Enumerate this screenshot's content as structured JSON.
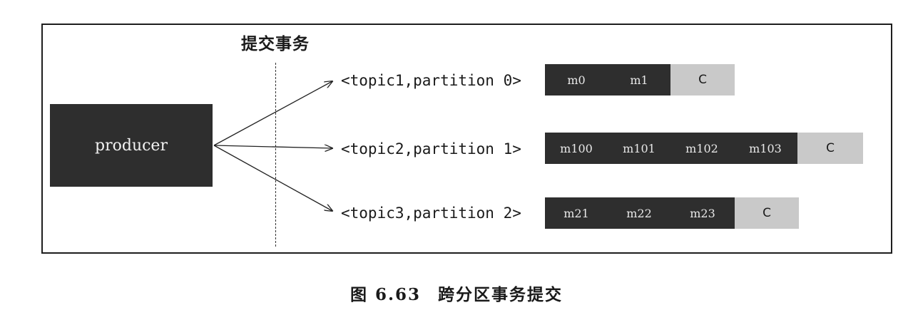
{
  "section_label": "提交事务",
  "producer": {
    "label": "producer"
  },
  "partitions": [
    {
      "label": "<topic1,partition 0>",
      "messages": [
        "m0",
        "m1"
      ],
      "commit": "C"
    },
    {
      "label": "<topic2,partition 1>",
      "messages": [
        "m100",
        "m101",
        "m102",
        "m103"
      ],
      "commit": "C"
    },
    {
      "label": "<topic3,partition 2>",
      "messages": [
        "m21",
        "m22",
        "m23"
      ],
      "commit": "C"
    }
  ],
  "caption": {
    "figure_number": "图 6.63",
    "title": "跨分区事务提交"
  },
  "colors": {
    "message_fill": "#2e2e2e",
    "commit_fill": "#c9c9c9",
    "producer_fill": "#2e2e2e"
  }
}
